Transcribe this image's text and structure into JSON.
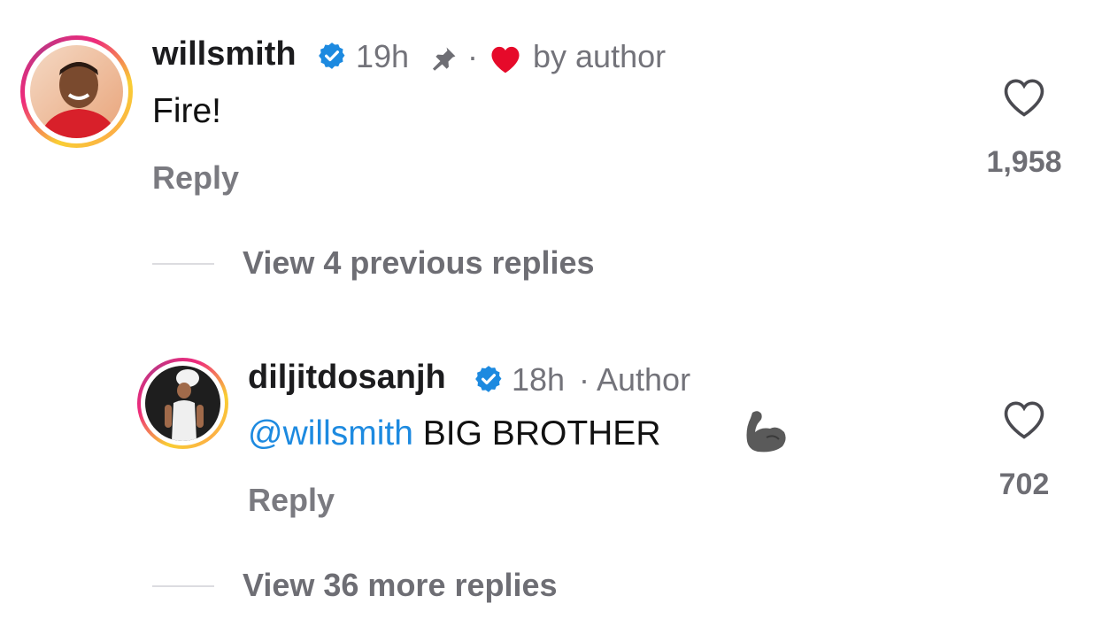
{
  "comment": {
    "username": "willsmith",
    "time": "19h",
    "dot": "·",
    "liked_by": "by author",
    "text": "Fire!",
    "reply_label": "Reply",
    "like_count": "1,958"
  },
  "view_previous": {
    "label": "View 4 previous replies"
  },
  "reply": {
    "username": "diljitdosanjh",
    "time": "18h",
    "author_badge": "· Author",
    "mention": "@willsmith",
    "text": "BIG BROTHER",
    "emoji": "💪🏿",
    "reply_label": "Reply",
    "like_count": "702"
  },
  "view_more": {
    "label": "View 36 more replies"
  },
  "colors": {
    "verified": "#1d8ae0",
    "heart_red": "#e60a2a",
    "mention": "#1d8ae0"
  }
}
